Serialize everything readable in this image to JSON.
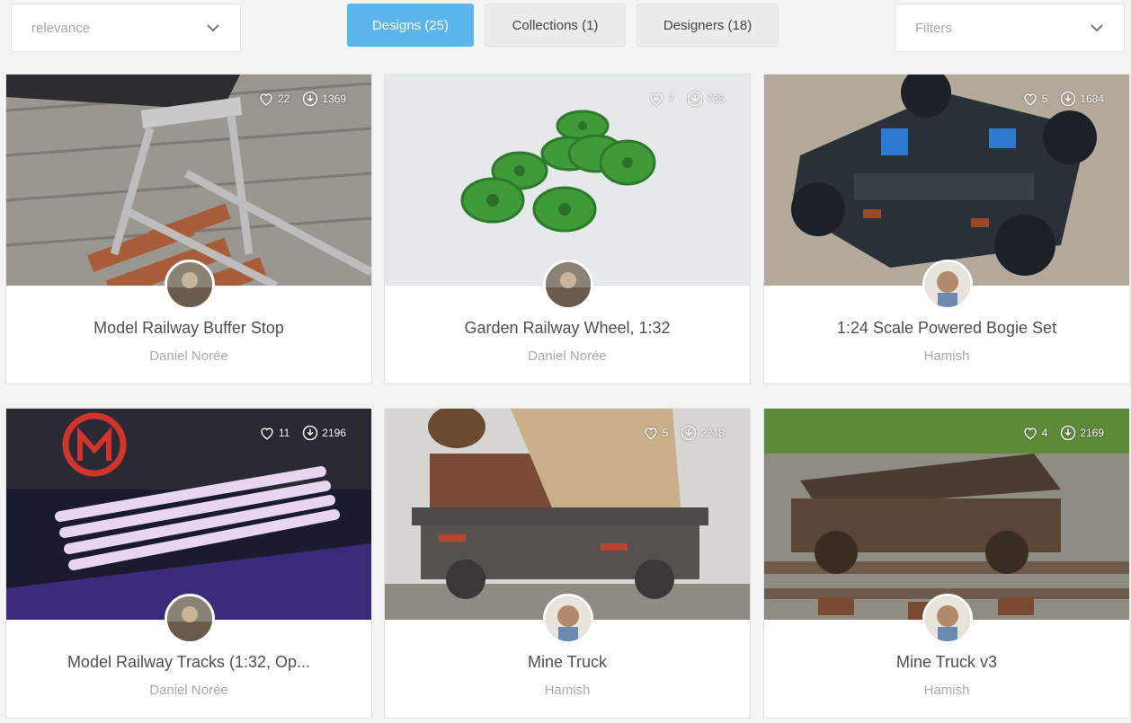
{
  "sort": {
    "value": "relevance"
  },
  "filters": {
    "placeholder": "Filters"
  },
  "tabs": [
    {
      "label": "Designs (25)",
      "active": true
    },
    {
      "label": "Collections (1)",
      "active": false
    },
    {
      "label": "Designers (18)",
      "active": false
    }
  ],
  "cards": [
    {
      "title": "Model Railway Buffer Stop",
      "author": "Daniel Norée",
      "likes": "22",
      "downloads": "1369"
    },
    {
      "title": "Garden Railway Wheel, 1:32",
      "author": "Daniel Norée",
      "likes": "7",
      "downloads": "735"
    },
    {
      "title": "1:24 Scale Powered Bogie Set",
      "author": "Hamish",
      "likes": "5",
      "downloads": "1684"
    },
    {
      "title": "Model Railway Tracks (1:32, Op...",
      "author": "Daniel Norée",
      "likes": "11",
      "downloads": "2196"
    },
    {
      "title": "Mine Truck",
      "author": "Hamish",
      "likes": "5",
      "downloads": "2218"
    },
    {
      "title": "Mine Truck v3",
      "author": "Hamish",
      "likes": "4",
      "downloads": "2169"
    }
  ],
  "colors": {
    "accent": "#5bb5ea",
    "page_bg": "#f4f4f4",
    "tab_bg": "#ececec"
  },
  "icons": {
    "likes": "heart-icon",
    "downloads": "download-icon",
    "dropdown": "chevron-down-icon"
  }
}
